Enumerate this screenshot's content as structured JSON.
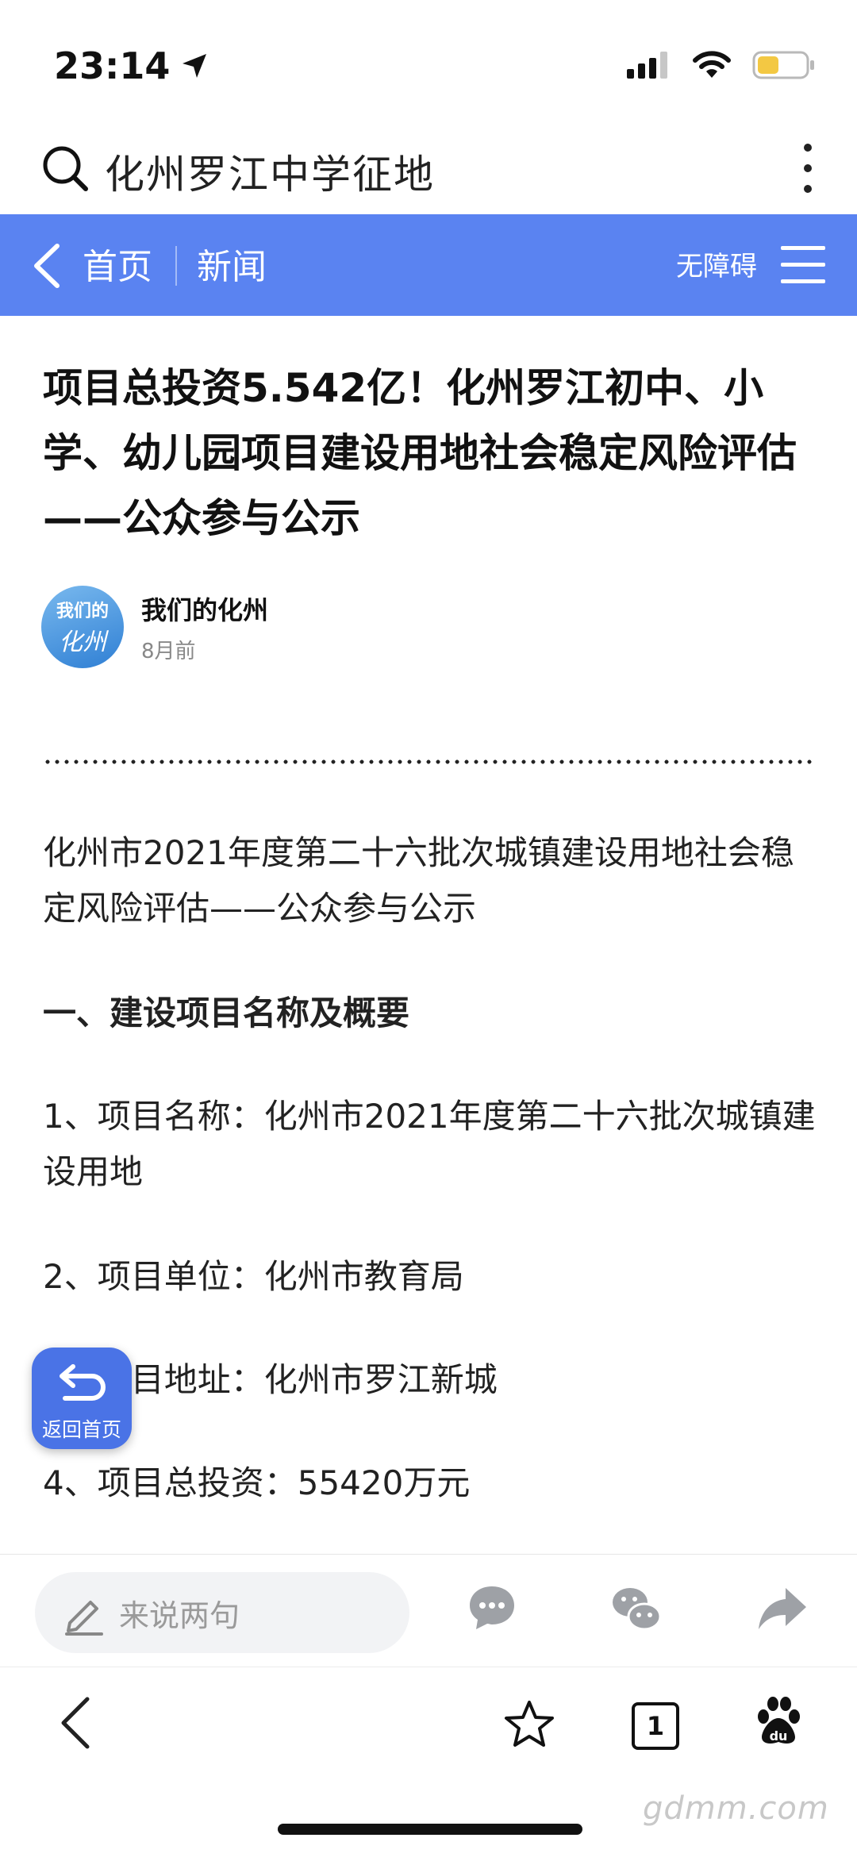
{
  "status_bar": {
    "time": "23:14"
  },
  "search": {
    "query": "化州罗江中学征地"
  },
  "nav": {
    "home": "首页",
    "news": "新闻",
    "accessibility": "无障碍"
  },
  "article": {
    "title": "项目总投资5.542亿！化州罗江初中、小学、幼儿园项目建设用地社会稳定风险评估——公众参与公示",
    "author": {
      "avatar_line1": "我们的",
      "avatar_line2": "化州",
      "name": "我们的化州",
      "time": "8月前"
    },
    "intro": "化州市2021年度第二十六批次城镇建设用地社会稳定风险评估——公众参与公示",
    "section_heading": "一、建设项目名称及概要",
    "items": [
      "1、项目名称：化州市2021年度第二十六批次城镇建设用地",
      "2、项目单位：化州市教育局",
      "3、项目地址：化州市罗江新城",
      "4、项目总投资：55420万元"
    ]
  },
  "fab": {
    "label": "返回首页"
  },
  "comment": {
    "placeholder": "来说两句"
  },
  "browser": {
    "tab_count": "1"
  },
  "watermark": "gdmm.com",
  "colors": {
    "accent": "#5a83f1",
    "fab": "#4a73e6"
  }
}
